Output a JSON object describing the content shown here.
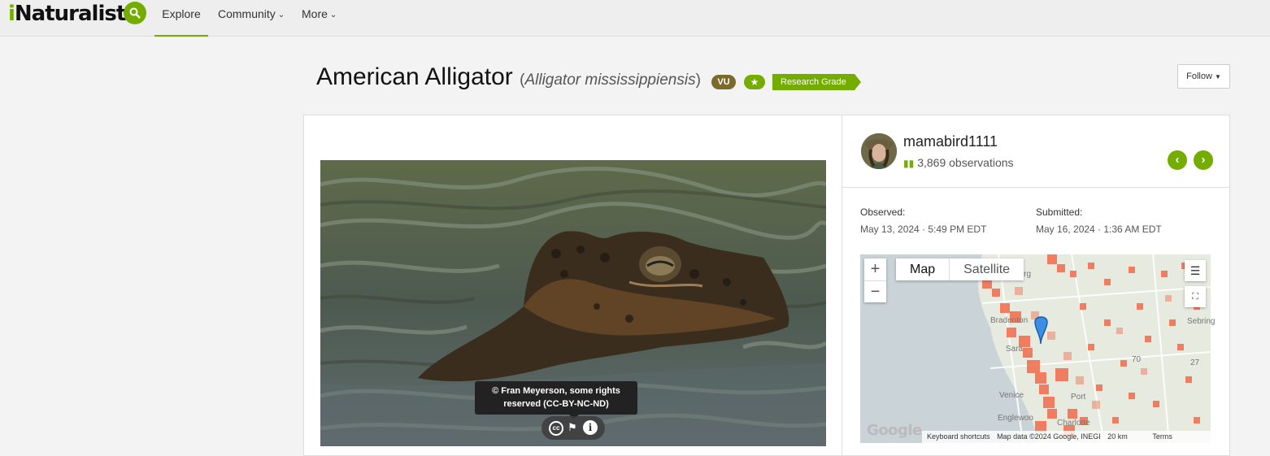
{
  "nav": {
    "logo": "iNaturalist",
    "items": [
      {
        "label": "Explore"
      },
      {
        "label": "Community"
      },
      {
        "label": "More"
      }
    ]
  },
  "header": {
    "common_name": "American Alligator",
    "scientific_name": "Alligator mississippiensis",
    "conservation_status": "VU",
    "quality_grade": "Research Grade",
    "follow_label": "Follow"
  },
  "photo": {
    "attribution_line1": "© Fran Meyerson, some rights",
    "attribution_line2": "reserved (CC-BY-NC-ND)",
    "cc_icon": "cc-license-icon",
    "flag_icon": "flag-icon",
    "info_icon": "info-icon"
  },
  "observer": {
    "username": "mamabird1111",
    "observations": "3,869 observations"
  },
  "details": {
    "observed_label": "Observed:",
    "observed_value": "May 13, 2024 · 5:49 PM EDT",
    "submitted_label": "Submitted:",
    "submitted_value": "May 16, 2024 · 1:36 AM EDT"
  },
  "map": {
    "type_map": "Map",
    "type_satellite": "Satellite",
    "zoom_in": "+",
    "zoom_out": "−",
    "google": "Google",
    "footer": {
      "shortcuts": "Keyboard shortcuts",
      "data": "Map data ©2024 Google, INEGI",
      "scale": "20 km",
      "terms": "Terms"
    },
    "places": [
      "burg",
      "Bradenton",
      "Sara",
      "Venice",
      "Englewoo",
      "Sebring",
      "Port",
      "70",
      "27",
      "Charlotte"
    ]
  },
  "colors": {
    "brand": "#74ac00",
    "vu_badge": "#7a6a2c",
    "heat": "#f26b4a"
  }
}
